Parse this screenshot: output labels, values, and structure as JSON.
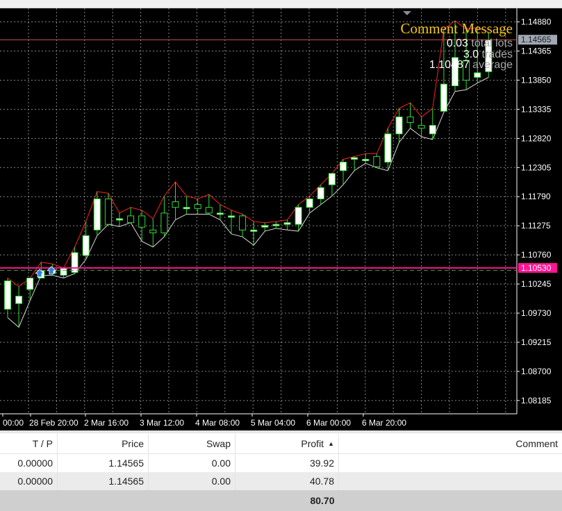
{
  "chart": {
    "comment": {
      "title": "Comment Message",
      "lots_value": "0.03",
      "lots_label": "total lots",
      "trades_value": "3.0",
      "trades_label": "trades",
      "avg_value": "1.10487",
      "avg_label": "average"
    },
    "price_ticks": [
      "1.14880",
      "1.14365",
      "1.13850",
      "1.13335",
      "1.12820",
      "1.12305",
      "1.11790",
      "1.11275",
      "1.10760",
      "1.10245",
      "1.09730",
      "1.09215",
      "1.08700",
      "1.08185"
    ],
    "time_ticks": [
      "00:00",
      "28 Feb 20:00",
      "2 Mar 16:00",
      "3 Mar 12:00",
      "4 Mar 08:00",
      "5 Mar 04:00",
      "6 Mar 00:00",
      "6 Mar 20:00"
    ],
    "current_price_label": "1.14565",
    "order_line_label": "1.10530",
    "price_range": [
      1.0795,
      1.1512
    ],
    "current_price": 1.14565,
    "order_price": 1.1053,
    "avg_price": 1.10487,
    "colors": {
      "background": "#000000",
      "grid": "#c0c0c0",
      "bull_candle": "#ffffff",
      "bear_candle": "#000000",
      "candle_wick": "#33dd33",
      "upper_envelope": "#ff2020",
      "lower_envelope": "#d8d8d8",
      "order_line": "#ff1493",
      "current_price_line": "#d05060",
      "average_line": "#33aa33",
      "comment_title": "#f5c518"
    }
  },
  "candles": [
    {
      "o": 1.098,
      "h": 1.1035,
      "l": 1.0965,
      "c": 1.103
    },
    {
      "o": 1.099,
      "h": 1.102,
      "l": 1.0948,
      "c": 1.1003
    },
    {
      "o": 1.1015,
      "h": 1.1035,
      "l": 1.0995,
      "c": 1.1035
    },
    {
      "o": 1.1035,
      "h": 1.1063,
      "l": 1.104,
      "c": 1.1048
    },
    {
      "o": 1.1043,
      "h": 1.106,
      "l": 1.104,
      "c": 1.105
    },
    {
      "o": 1.104,
      "h": 1.1053,
      "l": 1.1035,
      "c": 1.1053
    },
    {
      "o": 1.1045,
      "h": 1.109,
      "l": 1.1043,
      "c": 1.108
    },
    {
      "o": 1.1075,
      "h": 1.1135,
      "l": 1.1068,
      "c": 1.111
    },
    {
      "o": 1.112,
      "h": 1.1188,
      "l": 1.111,
      "c": 1.1175
    },
    {
      "o": 1.1175,
      "h": 1.1185,
      "l": 1.113,
      "c": 1.113
    },
    {
      "o": 1.114,
      "h": 1.115,
      "l": 1.1126,
      "c": 1.114
    },
    {
      "o": 1.1145,
      "h": 1.116,
      "l": 1.1133,
      "c": 1.1133
    },
    {
      "o": 1.1145,
      "h": 1.1155,
      "l": 1.11,
      "c": 1.1125
    },
    {
      "o": 1.112,
      "h": 1.114,
      "l": 1.109,
      "c": 1.1115
    },
    {
      "o": 1.115,
      "h": 1.118,
      "l": 1.1108,
      "c": 1.1115
    },
    {
      "o": 1.117,
      "h": 1.1205,
      "l": 1.1138,
      "c": 1.116
    },
    {
      "o": 1.116,
      "h": 1.118,
      "l": 1.1148,
      "c": 1.116
    },
    {
      "o": 1.1165,
      "h": 1.1175,
      "l": 1.1148,
      "c": 1.1158
    },
    {
      "o": 1.116,
      "h": 1.1183,
      "l": 1.1148,
      "c": 1.115
    },
    {
      "o": 1.115,
      "h": 1.1165,
      "l": 1.1138,
      "c": 1.115
    },
    {
      "o": 1.1145,
      "h": 1.1155,
      "l": 1.1113,
      "c": 1.1145
    },
    {
      "o": 1.1145,
      "h": 1.1148,
      "l": 1.1108,
      "c": 1.112
    },
    {
      "o": 1.112,
      "h": 1.1135,
      "l": 1.1093,
      "c": 1.112
    },
    {
      "o": 1.1125,
      "h": 1.1133,
      "l": 1.1118,
      "c": 1.1128
    },
    {
      "o": 1.113,
      "h": 1.1135,
      "l": 1.1123,
      "c": 1.113
    },
    {
      "o": 1.113,
      "h": 1.1138,
      "l": 1.112,
      "c": 1.1133
    },
    {
      "o": 1.113,
      "h": 1.1165,
      "l": 1.1118,
      "c": 1.116
    },
    {
      "o": 1.116,
      "h": 1.118,
      "l": 1.115,
      "c": 1.1175
    },
    {
      "o": 1.1175,
      "h": 1.12,
      "l": 1.1165,
      "c": 1.1195
    },
    {
      "o": 1.12,
      "h": 1.122,
      "l": 1.118,
      "c": 1.122
    },
    {
      "o": 1.1225,
      "h": 1.1245,
      "l": 1.12,
      "c": 1.124
    },
    {
      "o": 1.1245,
      "h": 1.125,
      "l": 1.1225,
      "c": 1.1248
    },
    {
      "o": 1.1245,
      "h": 1.1255,
      "l": 1.1238,
      "c": 1.1245
    },
    {
      "o": 1.125,
      "h": 1.1255,
      "l": 1.123,
      "c": 1.1232
    },
    {
      "o": 1.124,
      "h": 1.13,
      "l": 1.1225,
      "c": 1.129
    },
    {
      "o": 1.129,
      "h": 1.1335,
      "l": 1.1275,
      "c": 1.132
    },
    {
      "o": 1.132,
      "h": 1.1345,
      "l": 1.13,
      "c": 1.131
    },
    {
      "o": 1.1305,
      "h": 1.132,
      "l": 1.1285,
      "c": 1.13
    },
    {
      "o": 1.129,
      "h": 1.1335,
      "l": 1.128,
      "c": 1.1305
    },
    {
      "o": 1.133,
      "h": 1.1475,
      "l": 1.1328,
      "c": 1.1378
    },
    {
      "o": 1.1375,
      "h": 1.149,
      "l": 1.1365,
      "c": 1.1425
    },
    {
      "o": 1.142,
      "h": 1.1475,
      "l": 1.1368,
      "c": 1.1385
    },
    {
      "o": 1.139,
      "h": 1.1478,
      "l": 1.138,
      "c": 1.1398
    },
    {
      "o": 1.14,
      "h": 1.147,
      "l": 1.139,
      "c": 1.1456
    }
  ],
  "terminal": {
    "headers": {
      "tp": "T / P",
      "price": "Price",
      "swap": "Swap",
      "profit": "Profit",
      "comment": "Comment",
      "sort_indicator": "▲"
    },
    "rows": [
      {
        "tp": "0.00000",
        "price": "1.14565",
        "swap": "0.00",
        "profit": "39.92",
        "comment": ""
      },
      {
        "tp": "0.00000",
        "price": "1.14565",
        "swap": "0.00",
        "profit": "40.78",
        "comment": ""
      }
    ],
    "total_profit": "80.70"
  }
}
